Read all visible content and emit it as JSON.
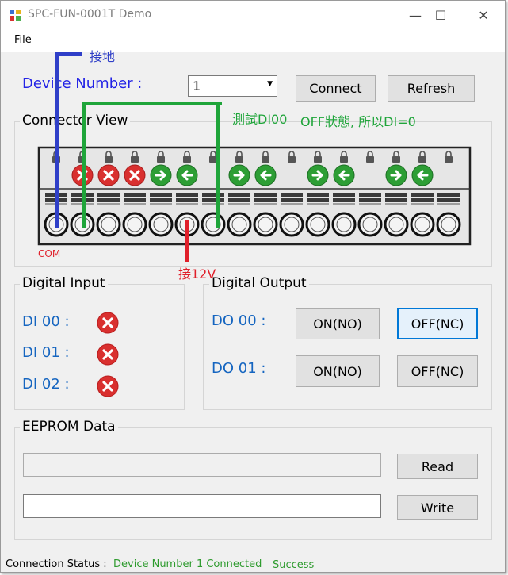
{
  "window": {
    "title": "SPC-FUN-0001T Demo",
    "minimize_glyph": "—",
    "maximize_glyph": "☐",
    "close_glyph": "✕"
  },
  "menu": {
    "file": "File"
  },
  "device": {
    "label": "Device Number :",
    "selected": "1",
    "connect": "Connect",
    "refresh": "Refresh"
  },
  "connector": {
    "title": "Connector View",
    "terminal_count": 16,
    "indicators": [
      "none",
      "red-x",
      "red-x",
      "red-x",
      "green-right",
      "green-left",
      "none",
      "green-right",
      "green-left",
      "none",
      "green-right",
      "green-left",
      "none",
      "green-right",
      "green-left",
      "none"
    ]
  },
  "digital_input": {
    "title": "Digital Input",
    "items": [
      {
        "label": "DI 00 :",
        "state": "off"
      },
      {
        "label": "DI 01 :",
        "state": "off"
      },
      {
        "label": "DI 02 :",
        "state": "off"
      }
    ]
  },
  "digital_output": {
    "title": "Digital Output",
    "items": [
      {
        "label": "DO 00 :",
        "on": "ON(NO)",
        "off": "OFF(NC)"
      },
      {
        "label": "DO 01 :",
        "on": "ON(NO)",
        "off": "OFF(NC)"
      }
    ]
  },
  "eeprom": {
    "title": "EEPROM Data",
    "read": "Read",
    "write": "Write",
    "read_value": "",
    "write_value": ""
  },
  "status": {
    "label": "Connection Status :",
    "message": "Device Number 1 Connected",
    "result": "Success"
  },
  "annotations": {
    "ground": "接地",
    "test": "測試DI00",
    "off_state": "OFF狀態, 所以DI=0",
    "com": "COM",
    "v12": "接12V"
  },
  "colors": {
    "blue_label": "#1565c0",
    "green_status": "#2e9b2e",
    "annot_blue": "#2f3fc8",
    "annot_green": "#1fa53a",
    "annot_red": "#e01f2a",
    "icon_red": "#d9302f",
    "icon_green": "#2d9e35"
  }
}
